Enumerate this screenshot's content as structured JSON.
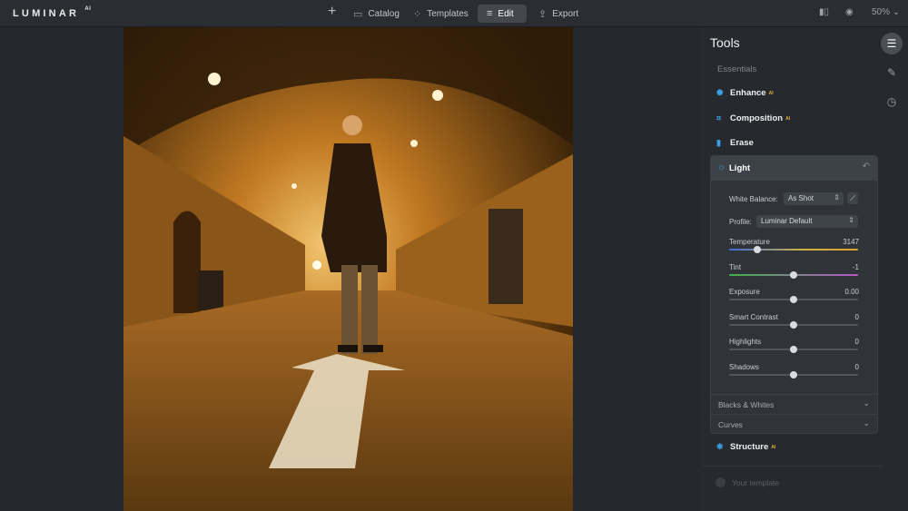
{
  "app": {
    "logo": "LUMINAR",
    "logo_sup": "AI"
  },
  "topnav": {
    "add_icon": "plus-icon",
    "catalog": "Catalog",
    "templates": "Templates",
    "edit": "Edit",
    "export": "Export",
    "zoom": "50%"
  },
  "panel": {
    "title": "Tools",
    "essentials_label": "Essentials",
    "tools": {
      "enhance": "Enhance",
      "composition": "Composition",
      "erase": "Erase",
      "structure": "Structure"
    },
    "ai_badge": "AI",
    "light": {
      "title": "Light",
      "white_balance_label": "White Balance:",
      "white_balance_value": "As Shot",
      "profile_label": "Profile:",
      "profile_value": "Luminar Default",
      "sliders": [
        {
          "label": "Temperature",
          "value": "3147",
          "fraction": 0.22
        },
        {
          "label": "Tint",
          "value": "-1",
          "fraction": 0.5
        },
        {
          "label": "Exposure",
          "value": "0.00",
          "fraction": 0.5
        },
        {
          "label": "Smart Contrast",
          "value": "0",
          "fraction": 0.5
        },
        {
          "label": "Highlights",
          "value": "0",
          "fraction": 0.5
        },
        {
          "label": "Shadows",
          "value": "0",
          "fraction": 0.5
        }
      ],
      "blacks_whites": "Blacks & Whites",
      "curves": "Curves"
    },
    "your_template": "Your template"
  },
  "colors": {
    "accent": "#3aa0e6",
    "ai_badge": "#e8b23b",
    "panel_bg": "#262a2e"
  }
}
